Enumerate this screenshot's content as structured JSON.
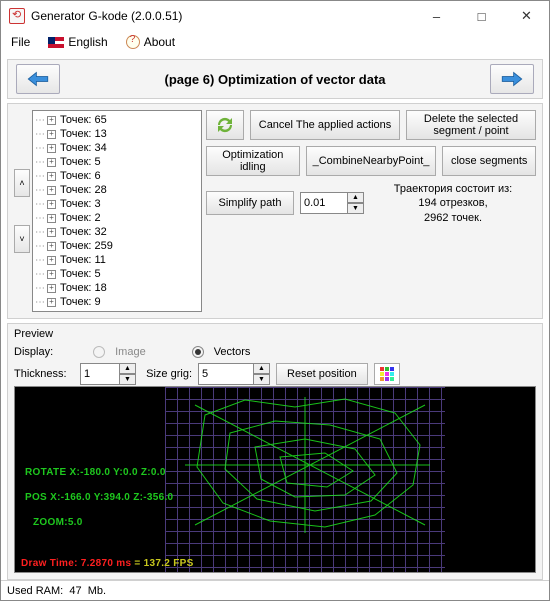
{
  "window": {
    "title": "Generator G-kode (2.0.0.51)"
  },
  "menu": {
    "file": "File",
    "lang": "English",
    "about": "About"
  },
  "page": {
    "title": "(page 6) Optimization of vector data",
    "cancel": "Cancel The applied actions",
    "delete_segment": "Delete the selected segment / point",
    "opt_idling": "Optimization idling",
    "combine": "_CombineNearbyPoint_",
    "close_segments": "close segments",
    "simplify": "Simplify path",
    "simplify_val": "0.01",
    "traj1": "Траектория состоит из:",
    "traj2": "194 отрезков,",
    "traj3": "2962 точек."
  },
  "tree": {
    "label": "Точек:",
    "items": [
      65,
      13,
      34,
      5,
      6,
      28,
      3,
      2,
      32,
      259,
      11,
      5,
      18,
      9
    ]
  },
  "preview": {
    "label": "Preview",
    "display": "Display:",
    "image": "Image",
    "vectors": "Vectors",
    "thickness": "Thickness:",
    "thickness_val": "1",
    "sizegrid": "Size grig:",
    "sizegrid_val": "5",
    "reset": "Reset position",
    "overlay_rotate": "ROTATE X:-180.0 Y:0.0 Z:0.0",
    "overlay_pos": "POS X:-166.0 Y:394.0 Z:-356.0",
    "overlay_zoom": "ZOOM:5.0",
    "overlay_drawtime_a": "Draw Time: 7.2870 ms",
    "overlay_drawtime_b": " = 137.2 FPS"
  },
  "status": {
    "ram_label": "Used RAM:",
    "ram_val": "47",
    "ram_unit": "Mb."
  }
}
